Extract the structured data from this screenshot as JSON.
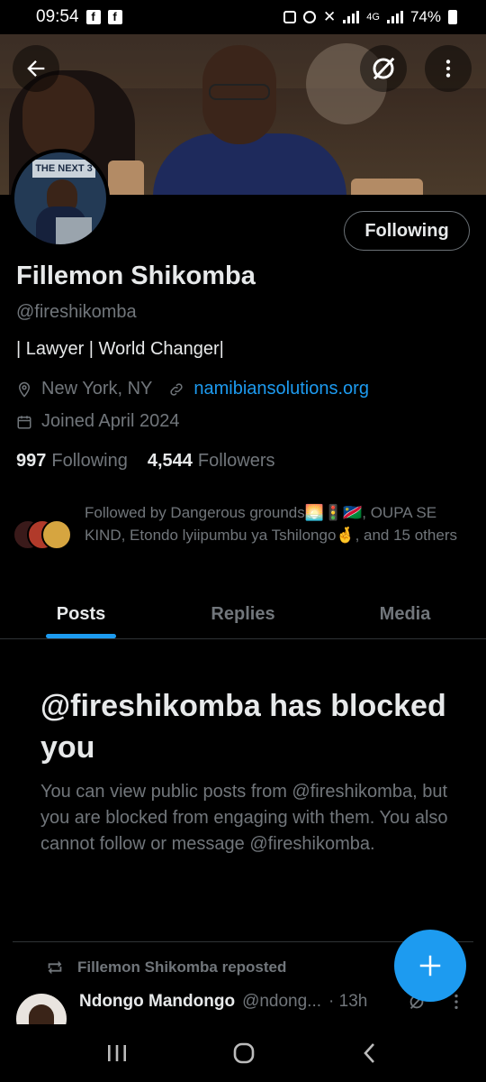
{
  "status_bar": {
    "time": "09:54",
    "left_badges": [
      "f",
      "f"
    ],
    "network": "4G",
    "battery": "74%"
  },
  "profile": {
    "name": "Fillemon Shikomba",
    "handle": "@fireshikomba",
    "bio": "| Lawyer | World Changer|",
    "location": "New York, NY",
    "website": "namibiansolutions.org",
    "joined": "Joined April 2024",
    "following_count": "997",
    "following_label": "Following",
    "followers_count": "4,544",
    "followers_label": "Followers",
    "follow_button": "Following",
    "followed_by_text": "Followed by Dangerous grounds🌅🚦🇳🇦, OUPA SE KIND, Etondo lyiipumbu ya Tshilongo🤞, and 15 others"
  },
  "avatar_banner_text": "THE NEXT 3",
  "tabs": [
    {
      "label": "Posts",
      "active": true
    },
    {
      "label": "Replies",
      "active": false
    },
    {
      "label": "Media",
      "active": false
    }
  ],
  "blocked": {
    "title": "@fireshikomba has blocked you",
    "body": "You can view public posts from @fireshikomba, but you are blocked from engaging with them. You also cannot follow or message @fireshikomba."
  },
  "tweet": {
    "repost_label": "Fillemon Shikomba reposted",
    "author_name": "Ndongo Mandongo",
    "author_handle": "@ndong...",
    "time": "· 13h"
  },
  "icons": {
    "back": "arrow-left-icon",
    "grok": "grok-icon",
    "more": "more-vertical-icon",
    "location": "location-pin-icon",
    "link": "link-icon",
    "calendar": "calendar-icon",
    "repost": "repost-icon",
    "compose": "plus-icon"
  },
  "colors": {
    "accent": "#1d9bf0",
    "muted": "#71767b",
    "text": "#e7e9ea",
    "background": "#000000"
  }
}
